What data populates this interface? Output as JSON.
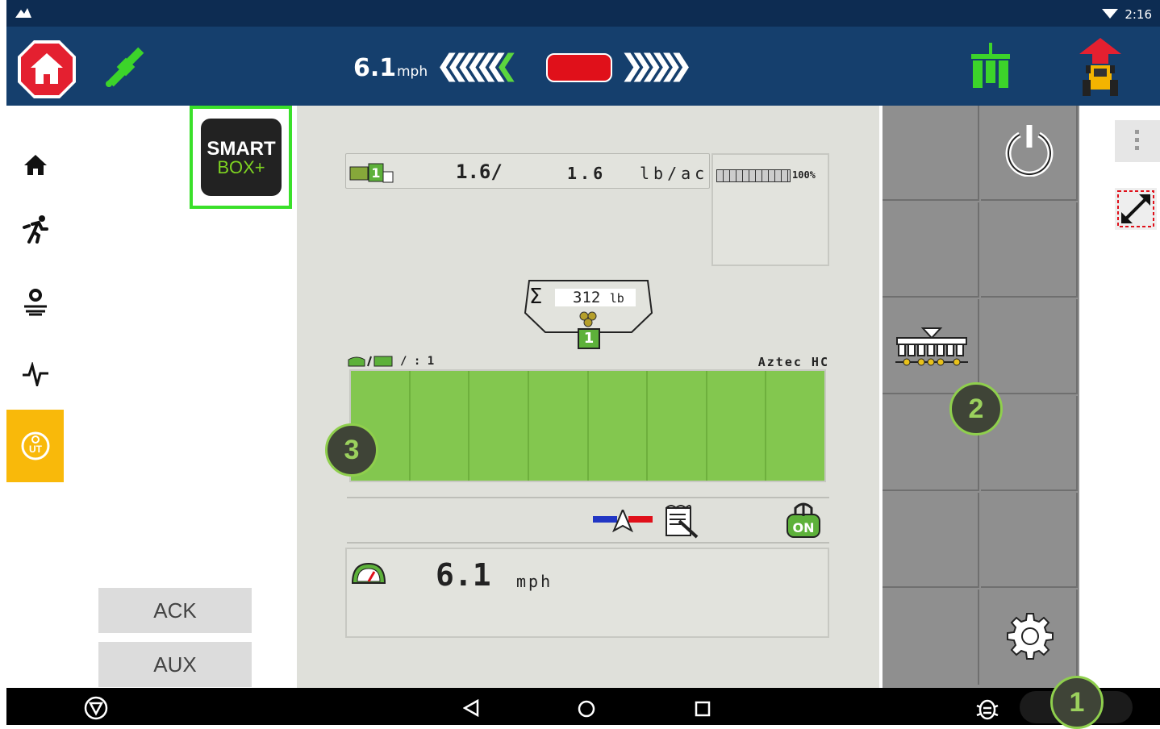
{
  "status": {
    "time": "2:16"
  },
  "topbar": {
    "speed_value": "6.1",
    "speed_unit": "mph"
  },
  "smartbox": {
    "line1": "SMART",
    "line2": "BOX+"
  },
  "buttons": {
    "ack": "ACK",
    "aux": "AUX"
  },
  "rate": {
    "left": "1.6/",
    "mid": "1.6",
    "unit": "lb/ac",
    "gauge_pct": "100%",
    "product_badge": "1"
  },
  "hopper": {
    "symbol": "Σ",
    "total": "312",
    "unit": "lb",
    "badge": "1"
  },
  "sections": {
    "header_left": "/ : 1",
    "implement_name": "Aztec HC",
    "count": 8
  },
  "ground_speed": {
    "value": "6.1",
    "unit": "mph"
  },
  "callouts": {
    "one": "1",
    "two": "2",
    "three": "3"
  },
  "colors": {
    "accent": "#f9b90a",
    "section_on": "#83c74f",
    "topbar": "#153f6d"
  }
}
